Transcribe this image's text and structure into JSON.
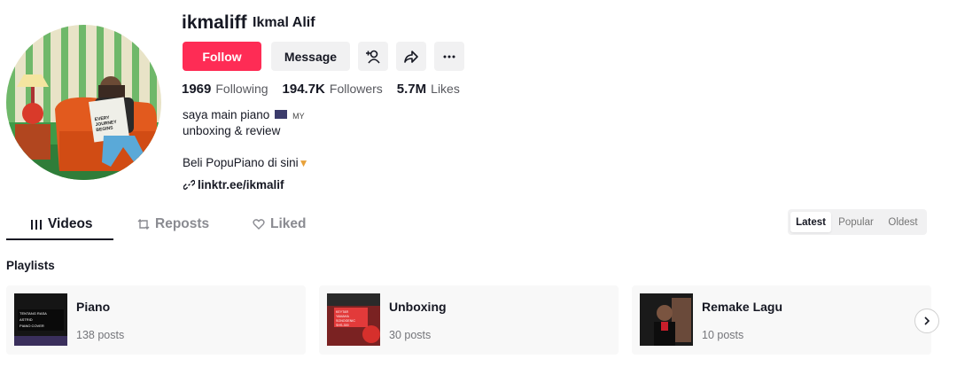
{
  "profile": {
    "username": "ikmaliff",
    "nickname": "Ikmal Alif",
    "avatar_text": "EVERY JOURNEY BEGINS"
  },
  "actions": {
    "follow_label": "Follow",
    "message_label": "Message",
    "add_friend_icon": "person-plus-icon",
    "share_icon": "share-arrow-icon",
    "more_icon": "more-dots-icon"
  },
  "stats": {
    "following_count": "1969",
    "following_label": "Following",
    "followers_count": "194.7K",
    "followers_label": "Followers",
    "likes_count": "5.7M",
    "likes_label": "Likes"
  },
  "bio": {
    "line1": "saya main piano",
    "line1_flag": "MY",
    "line2": "unboxing & review",
    "line3": "Beli PopuPiano di sini",
    "link": "linktr.ee/ikmalif"
  },
  "tabs": [
    {
      "label": "Videos",
      "icon": "grid-icon",
      "active": true
    },
    {
      "label": "Reposts",
      "icon": "repost-icon",
      "active": false
    },
    {
      "label": "Liked",
      "icon": "heart-outline-icon",
      "active": false
    }
  ],
  "sort": [
    {
      "label": "Latest",
      "active": true
    },
    {
      "label": "Popular",
      "active": false
    },
    {
      "label": "Oldest",
      "active": false
    }
  ],
  "playlists": {
    "heading": "Playlists",
    "items": [
      {
        "title": "Piano",
        "posts": "138 posts",
        "thumb_text": "TENTANG RASA ASTRID PIANO COVER"
      },
      {
        "title": "Unboxing",
        "posts": "30 posts",
        "thumb_text": "KEYTAR YAMAHA SONOGENIC SHS-300"
      },
      {
        "title": "Remake Lagu",
        "posts": "10 posts",
        "thumb_text": ""
      }
    ]
  },
  "colors": {
    "accent": "#fe2c55",
    "text": "#161823",
    "muted": "#57585e",
    "button_bg": "#f1f1f2"
  }
}
